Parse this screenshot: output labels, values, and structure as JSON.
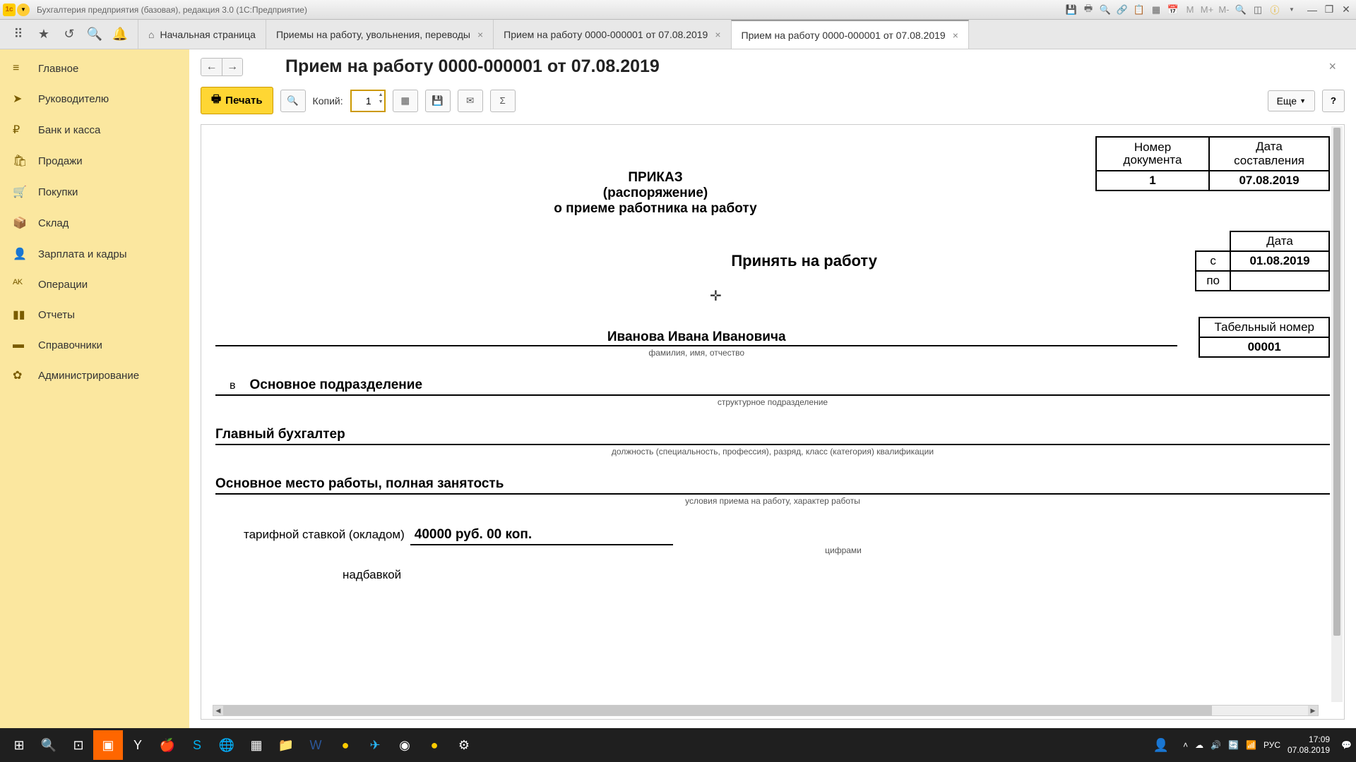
{
  "titlebar": {
    "title": "Бухгалтерия предприятия (базовая), редакция 3.0  (1С:Предприятие)"
  },
  "tabs": {
    "home": "Начальная страница",
    "t1": "Приемы на работу, увольнения, переводы",
    "t2": "Прием на работу 0000-000001 от 07.08.2019",
    "t3": "Прием на работу 0000-000001 от 07.08.2019"
  },
  "sidebar": {
    "items": [
      {
        "icon": "≡",
        "label": "Главное"
      },
      {
        "icon": "➤",
        "label": "Руководителю"
      },
      {
        "icon": "₽",
        "label": "Банк и касса"
      },
      {
        "icon": "🛍",
        "label": "Продажи"
      },
      {
        "icon": "🛒",
        "label": "Покупки"
      },
      {
        "icon": "📦",
        "label": "Склад"
      },
      {
        "icon": "👤",
        "label": "Зарплата и кадры"
      },
      {
        "icon": "ᴬᴷ",
        "label": "Операции"
      },
      {
        "icon": "▮▮",
        "label": "Отчеты"
      },
      {
        "icon": "▬",
        "label": "Справочники"
      },
      {
        "icon": "✿",
        "label": "Администрирование"
      }
    ]
  },
  "page": {
    "title": "Прием на работу 0000-000001 от 07.08.2019",
    "print_btn": "Печать",
    "copies_label": "Копий:",
    "copies_value": "1",
    "more_btn": "Еще",
    "help_btn": "?"
  },
  "doc": {
    "prikaz1": "ПРИКАЗ",
    "prikaz2": "(распоряжение)",
    "prikaz3": "о приеме работника на работу",
    "num_header": "Номер документа",
    "date_header": "Дата составления",
    "num_val": "1",
    "date_val": "07.08.2019",
    "accept": "Принять на работу",
    "date_label": "Дата",
    "from_label": "с",
    "to_label": "по",
    "from_val": "01.08.2019",
    "to_val": "",
    "tabnum_label": "Табельный номер",
    "tabnum_val": "00001",
    "fio": "Иванова Ивана Ивановича",
    "fio_note": "фамилия, имя, отчество",
    "dept_prefix": "в",
    "dept": "Основное подразделение",
    "dept_note": "структурное подразделение",
    "position": "Главный бухгалтер",
    "position_note": "должность (специальность, профессия), разряд, класс (категория) квалификации",
    "conditions": "Основное место работы, полная занятость",
    "conditions_note": "условия приема на работу, характер работы",
    "salary_label": "тарифной ставкой (окладом)",
    "salary_val": "40000 руб. 00 коп.",
    "salary_note": "цифрами",
    "nadbav": "надбавкой"
  },
  "taskbar": {
    "lang": "РУС",
    "time": "17:09",
    "date": "07.08.2019"
  }
}
